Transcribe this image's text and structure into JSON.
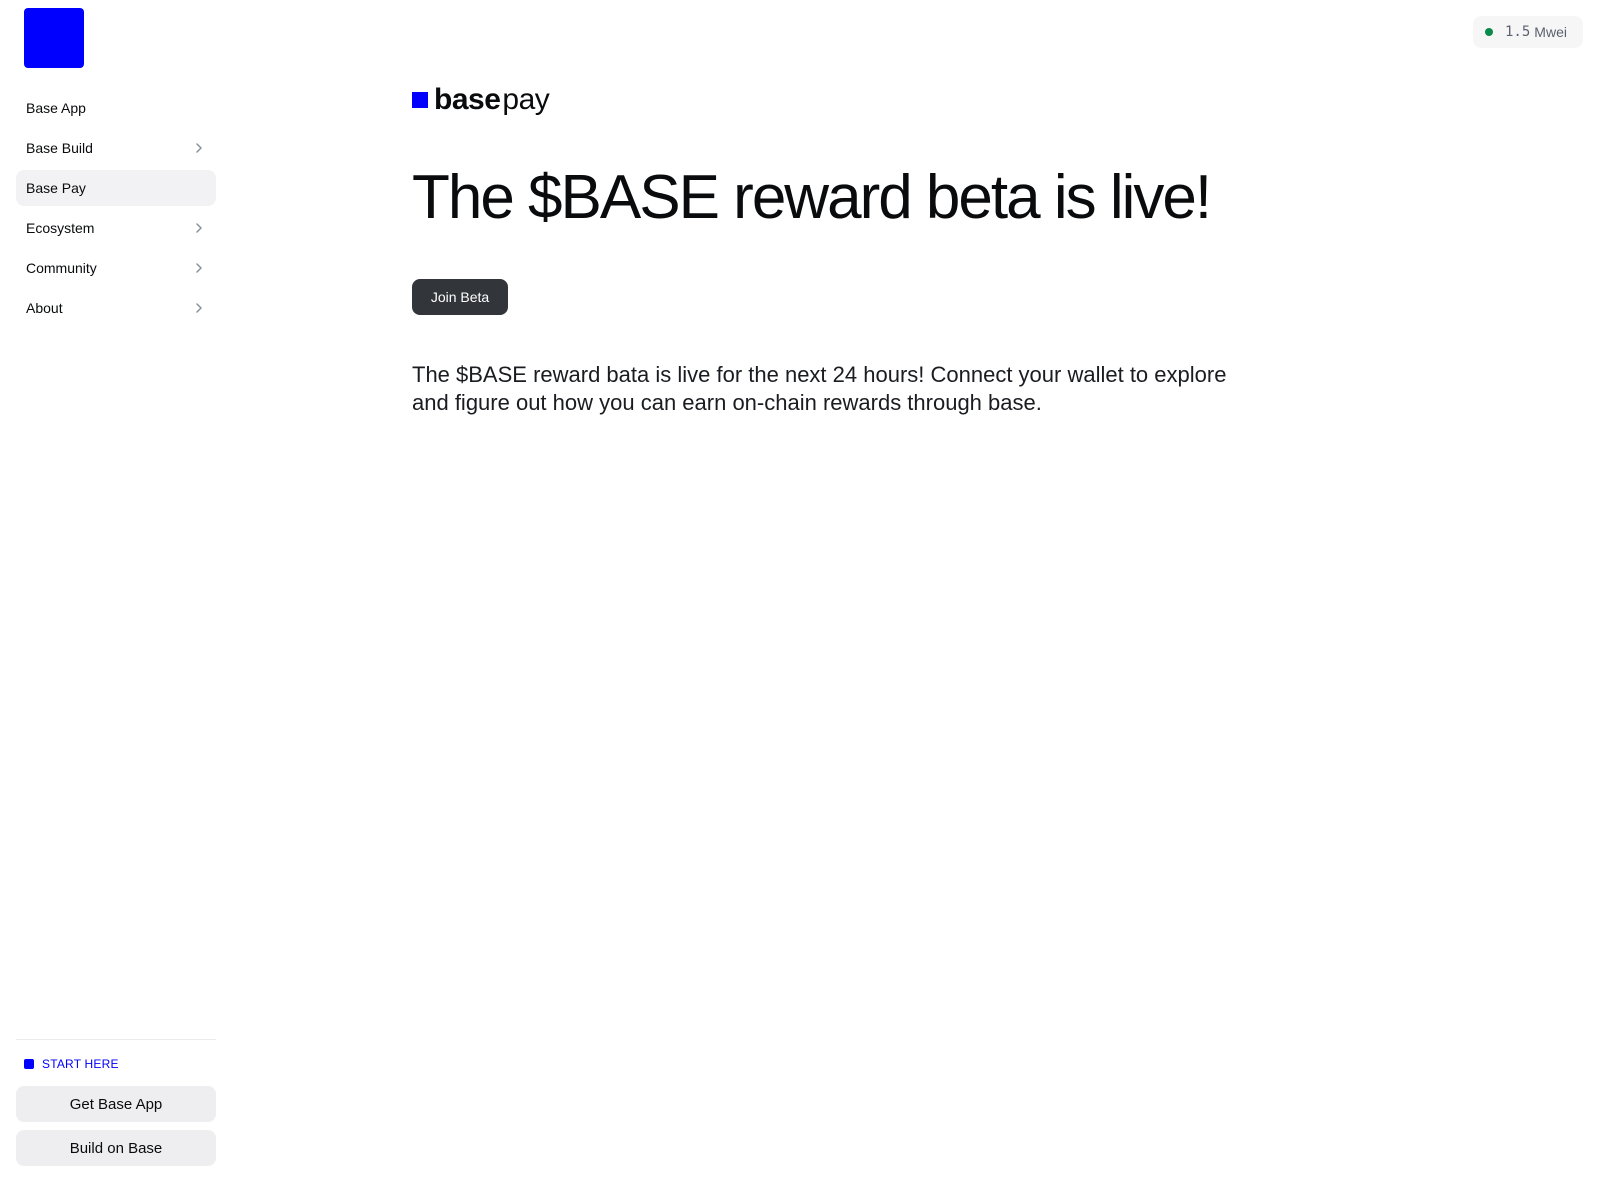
{
  "sidebar": {
    "nav_items": [
      {
        "label": "Base App",
        "has_chevron": false,
        "active": false
      },
      {
        "label": "Base Build",
        "has_chevron": true,
        "active": false
      },
      {
        "label": "Base Pay",
        "has_chevron": false,
        "active": true
      },
      {
        "label": "Ecosystem",
        "has_chevron": true,
        "active": false
      },
      {
        "label": "Community",
        "has_chevron": true,
        "active": false
      },
      {
        "label": "About",
        "has_chevron": true,
        "active": false
      }
    ],
    "start_here_label": "START HERE",
    "get_app_label": "Get Base App",
    "build_label": "Build on Base"
  },
  "gas": {
    "value": "1.5",
    "unit": "Mwei"
  },
  "main": {
    "brand_bold": "base",
    "brand_light": "pay",
    "headline": "The $BASE reward beta is live!",
    "join_button_label": "Join Beta",
    "description": "The $BASE reward bata is live for the next 24 hours! Connect your wallet to explore and figure out how you can earn on-chain rewards through base."
  },
  "colors": {
    "brand_blue": "#0000ff",
    "status_green": "#0a8a4a",
    "button_dark": "#32353a"
  },
  "icons": {
    "chevron": "chevron-right-icon",
    "logo": "base-logo-square"
  }
}
